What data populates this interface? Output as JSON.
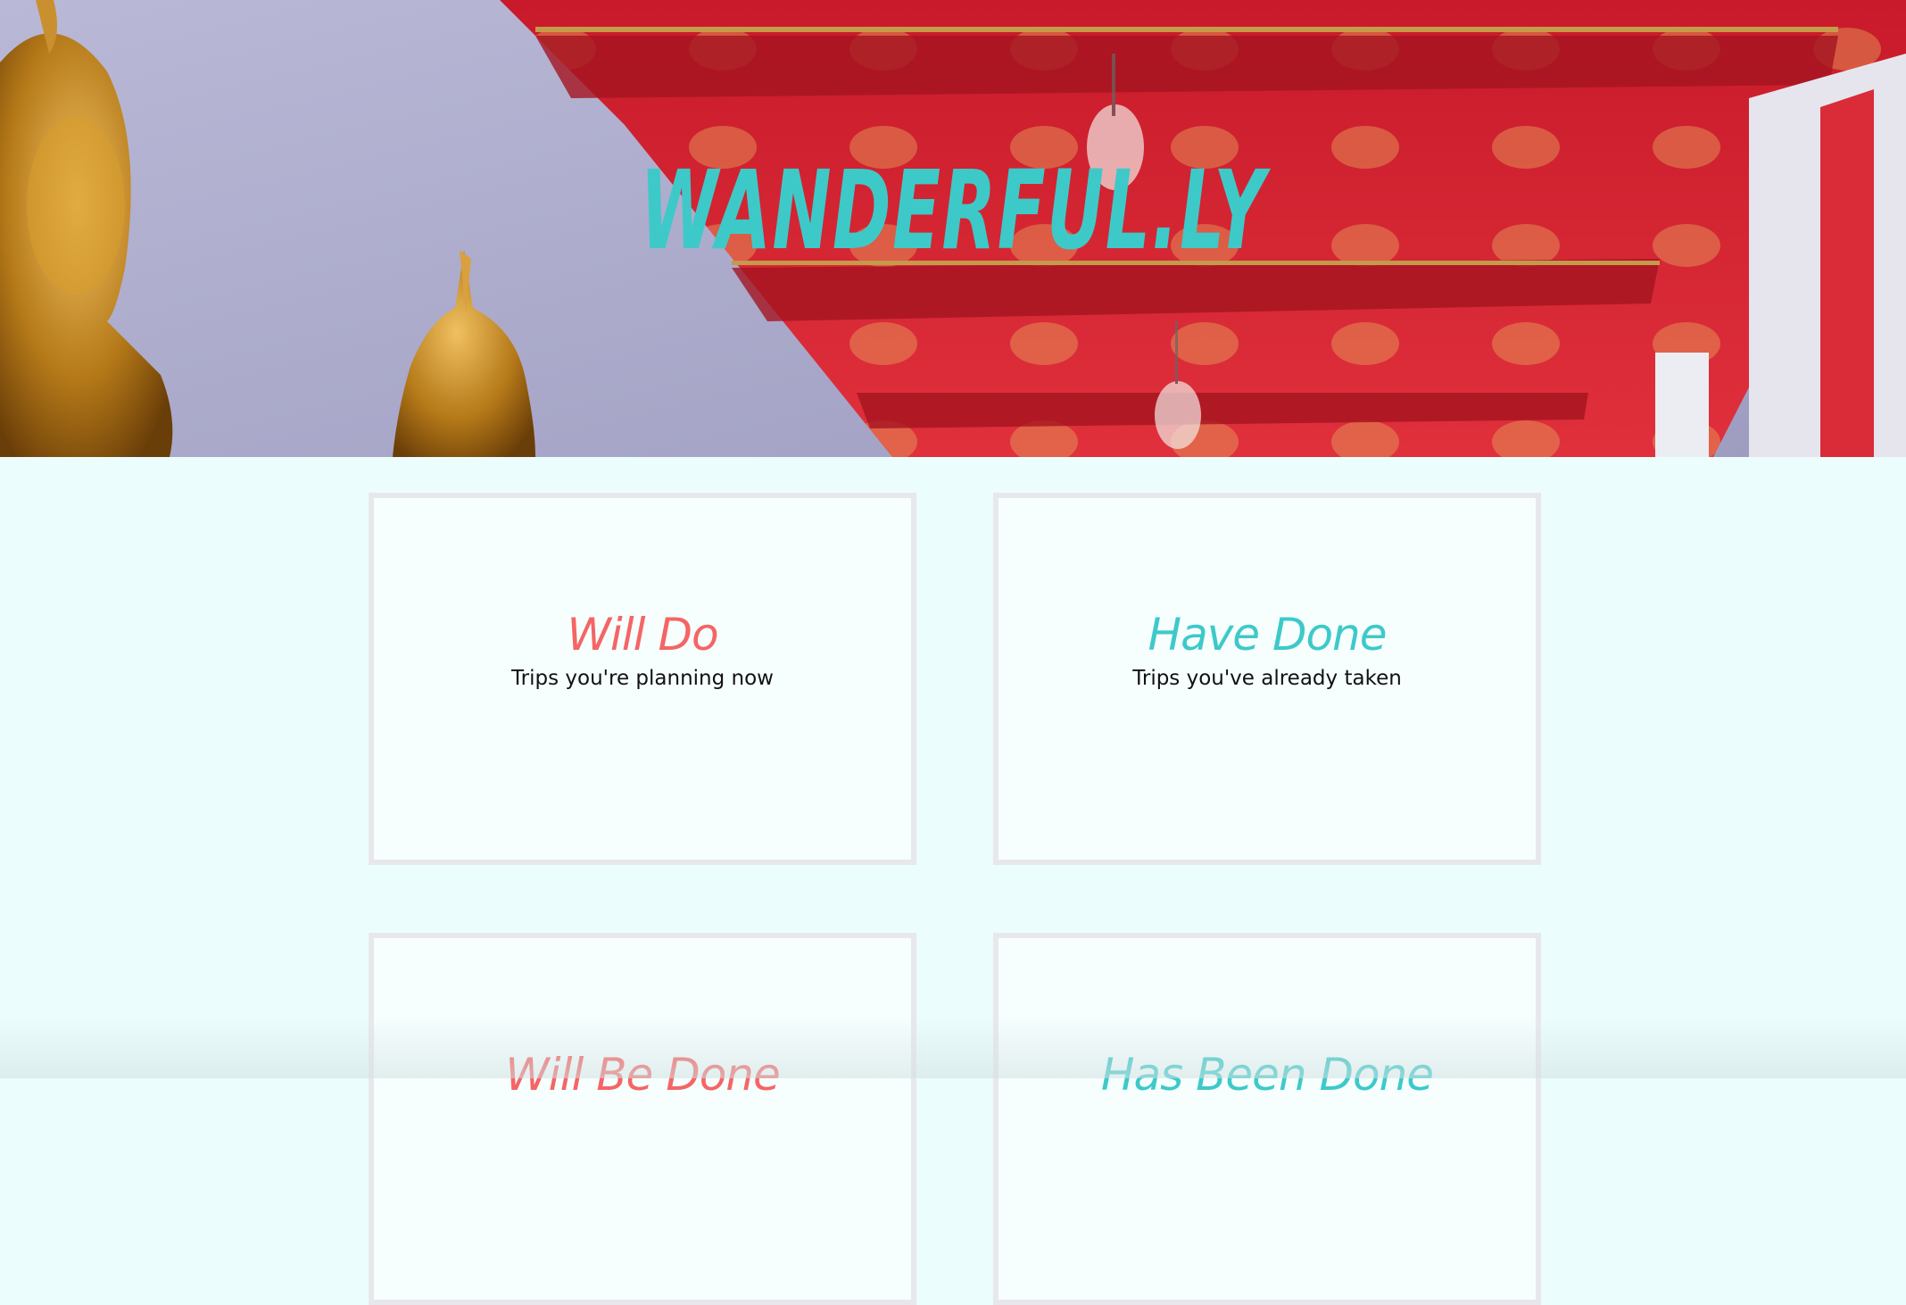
{
  "header": {
    "brand": "Wanderful.ly",
    "background_image": "temple-buddha-photo"
  },
  "colors": {
    "page_background": "#ebfdfd",
    "card_background": "#f6fefe",
    "card_border": "#e8e8ec",
    "coral": "#f56565",
    "teal": "#3ec9c9"
  },
  "cards": [
    {
      "title": "Will Do",
      "subtitle": "Trips you're planning now",
      "accent": "coral"
    },
    {
      "title": "Have Done",
      "subtitle": "Trips you've already taken",
      "accent": "teal"
    },
    {
      "title": "Will Be Done",
      "subtitle": "",
      "accent": "coral"
    },
    {
      "title": "Has Been Done",
      "subtitle": "",
      "accent": "teal"
    }
  ]
}
